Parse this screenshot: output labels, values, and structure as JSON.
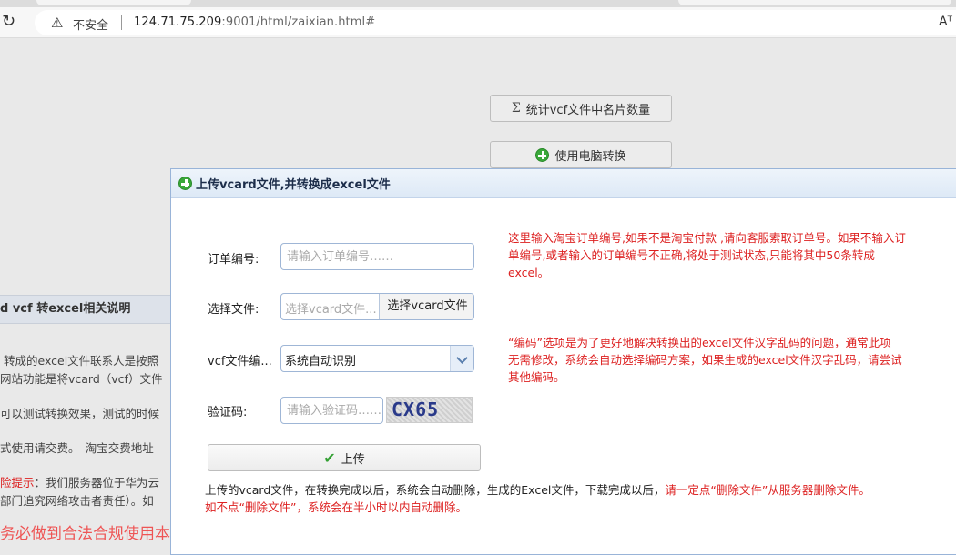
{
  "browser": {
    "reload_icon": "reload-icon",
    "security_label": "不安全",
    "url_host": "124.71.75.209",
    "url_rest": ":9001/html/zaixian.html#",
    "read_mode_label": "Aᵀ"
  },
  "page": {
    "count_button": "统计vcf文件中名片数量",
    "count_symbol": "Σ",
    "convert_button": "使用电脑转换",
    "left_panel": {
      "title": "d vcf 转excel相关说明",
      "lines": [
        "转成的excel文件联系人是按照",
        "网站功能是将vcard（vcf）文件",
        "可以测试转换效果，测试的时候",
        "式使用请交费。　淘宝交费地址",
        "险提示：我们服务器位于华为云",
        "部门追究网络攻击者责任）。如"
      ],
      "risk_prefix": "险提示",
      "risk_rest": "：我们服务器位于华为云",
      "bottom_line": "务必做到合法合规使用本"
    }
  },
  "dialog": {
    "title": "上传vcard文件,并转换成excel文件",
    "order": {
      "label": "订单编号:",
      "placeholder": "请输入订单编号……"
    },
    "file": {
      "label": "选择文件:",
      "placeholder": "选择vcard文件...",
      "button": "选择vcard文件"
    },
    "encoding": {
      "label": "vcf文件编...",
      "value": "系统自动识别"
    },
    "captcha": {
      "label": "验证码:",
      "placeholder": "请输入验证码……",
      "image_text": "CX65"
    },
    "upload_button": "上传",
    "order_note": [
      "这里输入淘宝订单编号,如果不是淘宝付款 ,请向客服索取订单号。如果不输入订",
      "单编号,或者输入的订单编号不正确,将处于测试状态,只能将其中50条转成",
      "excel。"
    ],
    "encoding_note": [
      "“编码”选项是为了更好地解决转换出的excel文件汉字乱码的问题，通常此项",
      "无需修改，系统会自动选择编码方案，如果生成的excel文件汉字乱码，请尝试",
      "其他编码。"
    ],
    "footer": {
      "line1_dark": "上传的vcard文件，在转换完成以后，系统会自动删除，生成的Excel文件，下载完成以后，",
      "line1_red": "请一定点“删除文件”从服务器删除文件。",
      "line2": "如不点“删除文件”，系统会在半小时以内自动删除。"
    }
  },
  "colors": {
    "accent_red": "#dd2222",
    "dialog_border": "#99b4d8",
    "plus_green": "#3aa83a"
  }
}
